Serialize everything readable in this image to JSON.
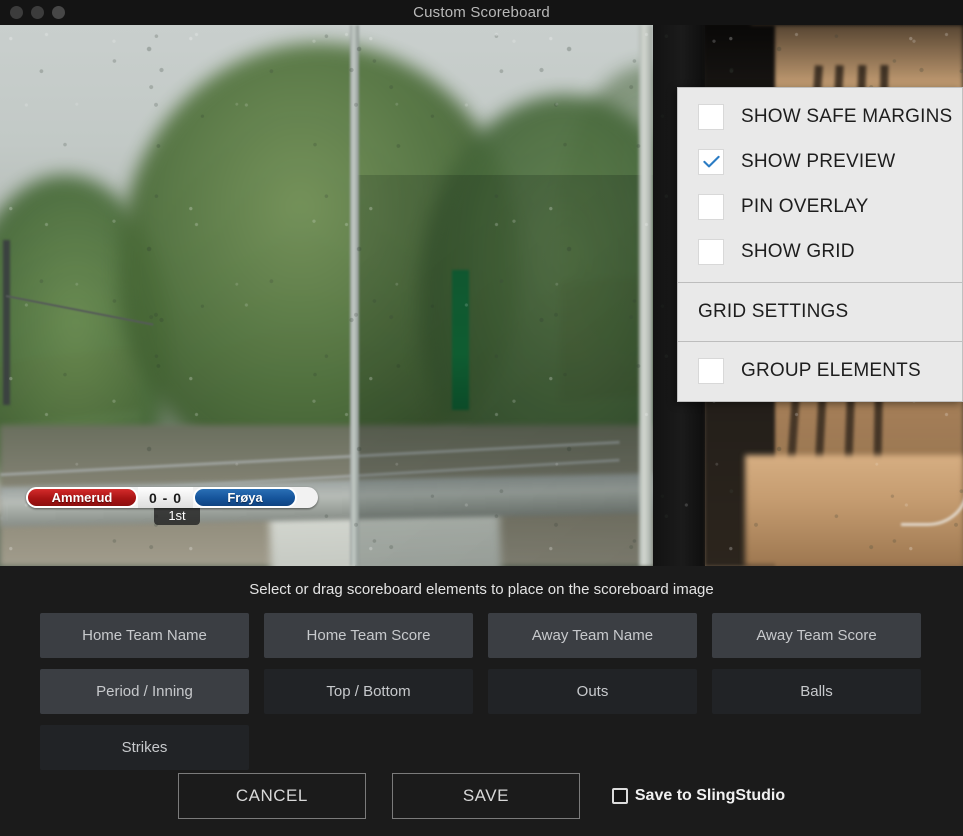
{
  "window": {
    "title": "Custom Scoreboard",
    "traffic_lights": [
      "close-button",
      "minimize-button",
      "zoom-button"
    ]
  },
  "overlay_menu": {
    "options": [
      {
        "label": "SHOW SAFE MARGINS",
        "checked": false,
        "name": "show-safe-margins"
      },
      {
        "label": "SHOW PREVIEW",
        "checked": true,
        "name": "show-preview"
      },
      {
        "label": "PIN OVERLAY",
        "checked": false,
        "name": "pin-overlay"
      },
      {
        "label": "SHOW GRID",
        "checked": false,
        "name": "show-grid"
      }
    ],
    "section_label": "GRID SETTINGS",
    "group_option": {
      "label": "GROUP ELEMENTS",
      "checked": false,
      "name": "group-elements"
    },
    "check_color": "#2b7cc4",
    "panel_bg": "#e9e9e9"
  },
  "scoreboard_overlay": {
    "home_team": "Ammerud",
    "score": "0 - 0",
    "away_team": "Frøya",
    "period": "1st",
    "home_color": "#a81414",
    "away_color": "#15549b"
  },
  "bottom": {
    "hint": "Select or drag scoreboard elements to place on the scoreboard image",
    "elements": [
      {
        "label": "Home Team Name",
        "active": true
      },
      {
        "label": "Home Team Score",
        "active": true
      },
      {
        "label": "Away Team Name",
        "active": true
      },
      {
        "label": "Away Team Score",
        "active": true
      },
      {
        "label": "Period / Inning",
        "active": true
      },
      {
        "label": "Top / Bottom",
        "active": false
      },
      {
        "label": "Outs",
        "active": false
      },
      {
        "label": "Balls",
        "active": false
      },
      {
        "label": "Strikes",
        "active": false
      }
    ],
    "cancel_label": "CANCEL",
    "save_label": "SAVE",
    "save_to_slingstudio": {
      "label": "Save to SlingStudio",
      "checked": false
    }
  }
}
